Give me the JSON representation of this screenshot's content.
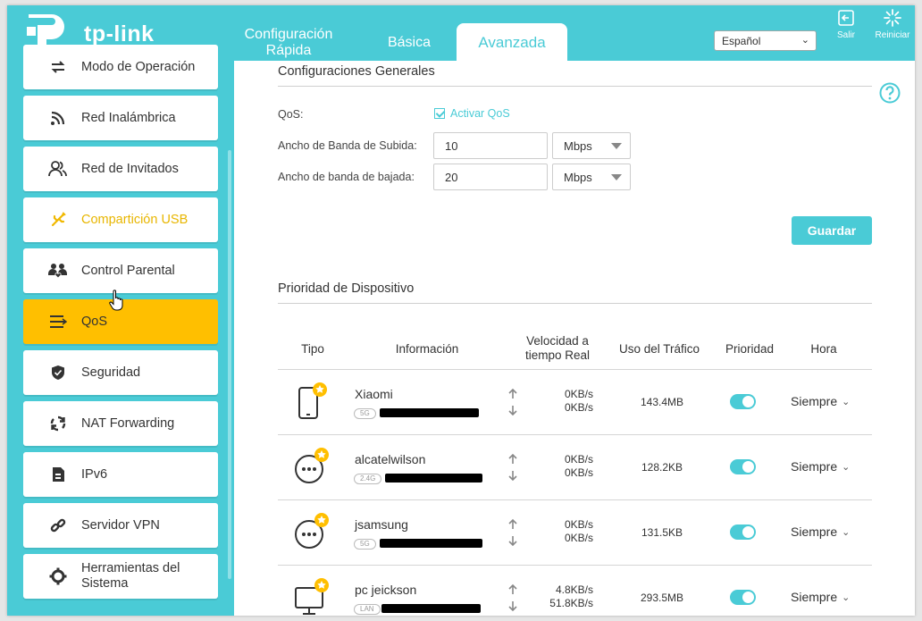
{
  "brand": {
    "logo_text": "tp-link",
    "accent": "#4acbd6",
    "active": "#ffbf00"
  },
  "tabs": [
    {
      "label": "Configuración Rápida"
    },
    {
      "label": "Básica"
    },
    {
      "label": "Avanzada"
    }
  ],
  "language": {
    "selected": "Español"
  },
  "header_buttons": {
    "exit": "Salir",
    "reboot": "Reiniciar"
  },
  "sidebar": {
    "items": [
      {
        "label": "Modo de Operación",
        "icon": "operation-mode-icon"
      },
      {
        "label": "Red Inalámbrica",
        "icon": "wireless-icon"
      },
      {
        "label": "Red de Invitados",
        "icon": "guest-network-icon"
      },
      {
        "label": "Compartición USB",
        "icon": "usb-icon"
      },
      {
        "label": "Control Parental",
        "icon": "parental-control-icon"
      },
      {
        "label": "QoS",
        "icon": "qos-icon"
      },
      {
        "label": "Seguridad",
        "icon": "shield-icon"
      },
      {
        "label": "NAT Forwarding",
        "icon": "nat-forwarding-icon"
      },
      {
        "label": "IPv6",
        "icon": "ipv6-icon"
      },
      {
        "label": "Servidor VPN",
        "icon": "vpn-icon"
      },
      {
        "label": "Herramientas del Sistema",
        "icon": "system-tools-icon"
      }
    ]
  },
  "general": {
    "title": "Configuraciones Generales",
    "qos_label": "QoS:",
    "qos_checkbox": "Activar QoS",
    "up_label": "Ancho de Banda de Subida:",
    "up_value": "10",
    "up_unit": "Mbps",
    "down_label": "Ancho de banda de bajada:",
    "down_value": "20",
    "down_unit": "Mbps",
    "save": "Guardar"
  },
  "devices": {
    "title": "Prioridad de Dispositivo",
    "headers": {
      "type": "Tipo",
      "info": "Información",
      "speed": "Velocidad a tiempo Real",
      "traffic": "Uso del Tráfico",
      "priority": "Prioridad",
      "time": "Hora"
    },
    "rows": [
      {
        "icon": "phone-icon",
        "name": "Xiaomi",
        "band": "5G",
        "up": "0KB/s",
        "down": "0KB/s",
        "traffic": "143.4MB",
        "priority": true,
        "time": "Siempre"
      },
      {
        "icon": "generic-device-icon",
        "name": "alcatelwilson",
        "band": "2.4G",
        "up": "0KB/s",
        "down": "0KB/s",
        "traffic": "128.2KB",
        "priority": true,
        "time": "Siempre"
      },
      {
        "icon": "generic-device-icon",
        "name": "jsamsung",
        "band": "5G",
        "up": "0KB/s",
        "down": "0KB/s",
        "traffic": "131.5KB",
        "priority": true,
        "time": "Siempre"
      },
      {
        "icon": "computer-icon",
        "name": "pc jeickson",
        "band": "LAN",
        "up": "4.8KB/s",
        "down": "51.8KB/s",
        "traffic": "293.5MB",
        "priority": true,
        "time": "Siempre"
      }
    ]
  }
}
